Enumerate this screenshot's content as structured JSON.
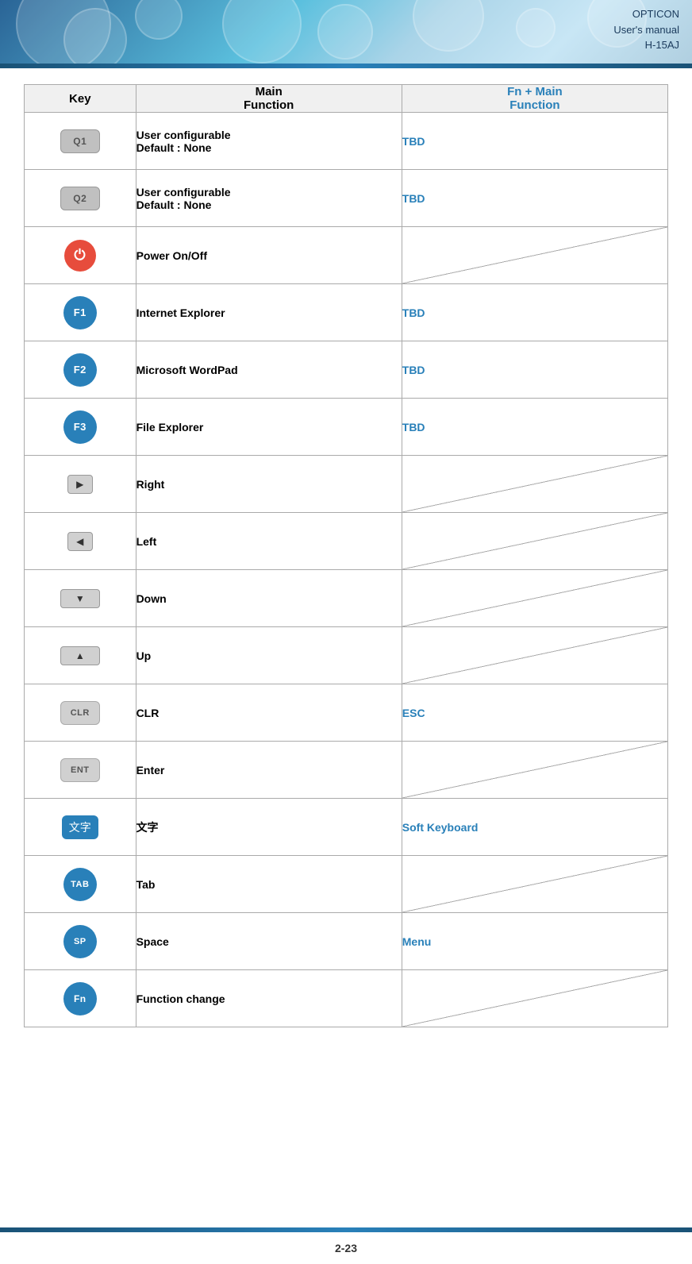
{
  "header": {
    "company": "OPTICON",
    "manual": "User's manual",
    "model": "H-15AJ"
  },
  "table": {
    "col_key": "Key",
    "col_main_line1": "Main",
    "col_main_line2": "Function",
    "col_fn_line1": "Fn + Main",
    "col_fn_line2": "Function",
    "rows": [
      {
        "key_label": "Q1",
        "key_type": "gray",
        "main": "User configurable\nDefault : None",
        "fn": "TBD",
        "fn_type": "tbd"
      },
      {
        "key_label": "Q2",
        "key_type": "gray",
        "main": "User configurable\nDefault : None",
        "fn": "TBD",
        "fn_type": "tbd"
      },
      {
        "key_label": "⏻",
        "key_type": "red",
        "main": "Power On/Off",
        "fn": "",
        "fn_type": "diagonal"
      },
      {
        "key_label": "F1",
        "key_type": "blue",
        "main": "Internet Explorer",
        "fn": "TBD",
        "fn_type": "tbd"
      },
      {
        "key_label": "F2",
        "key_type": "blue",
        "main": "Microsoft WordPad",
        "fn": "TBD",
        "fn_type": "tbd"
      },
      {
        "key_label": "F3",
        "key_type": "blue",
        "main": "File Explorer",
        "fn": "TBD",
        "fn_type": "tbd"
      },
      {
        "key_label": "▶",
        "key_type": "arrow-right",
        "main": "Right",
        "fn": "",
        "fn_type": "diagonal"
      },
      {
        "key_label": "◀",
        "key_type": "arrow-left",
        "main": "Left",
        "fn": "",
        "fn_type": "diagonal"
      },
      {
        "key_label": "▼",
        "key_type": "arrow-down-wide",
        "main": "Down",
        "fn": "",
        "fn_type": "diagonal"
      },
      {
        "key_label": "▲",
        "key_type": "arrow-up-wide",
        "main": "Up",
        "fn": "",
        "fn_type": "diagonal"
      },
      {
        "key_label": "CLR",
        "key_type": "clr",
        "main": "CLR",
        "fn": "ESC",
        "fn_type": "esc"
      },
      {
        "key_label": "ENT",
        "key_type": "ent",
        "main": "Enter",
        "fn": "",
        "fn_type": "diagonal"
      },
      {
        "key_label": "文字",
        "key_type": "kanji",
        "main": "文字",
        "fn": "Soft Keyboard",
        "fn_type": "tbd"
      },
      {
        "key_label": "TAB",
        "key_type": "tab",
        "main": "Tab",
        "fn": "",
        "fn_type": "diagonal"
      },
      {
        "key_label": "SP",
        "key_type": "sp",
        "main": "Space",
        "fn": "Menu",
        "fn_type": "tbd"
      },
      {
        "key_label": "Fn",
        "key_type": "fn",
        "main": "Function change",
        "fn": "",
        "fn_type": "diagonal"
      }
    ]
  },
  "footer": {
    "page": "2-23"
  }
}
